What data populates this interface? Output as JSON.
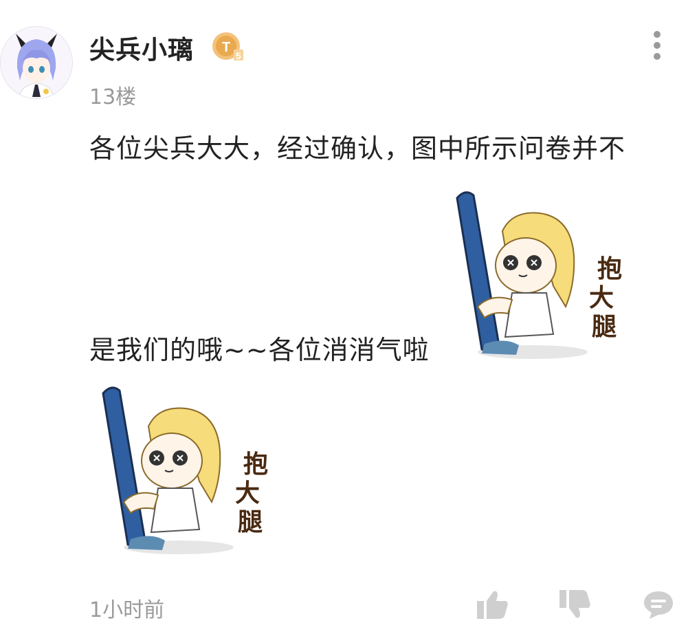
{
  "post": {
    "username": "尖兵小璃",
    "badge": "T5",
    "floor": "13楼",
    "content_line1": "各位尖兵大大，经过确认，图中所示问卷并不",
    "content_line2": "是我们的哦~~各位消消气啦",
    "sticker_text": [
      "抱",
      "大",
      "腿"
    ],
    "timestamp": "1小时前"
  },
  "icons": {
    "avatar": "anime-avatar-icon",
    "badge": "level-badge-icon",
    "more": "more-vertical-icon",
    "like": "thumbs-up-icon",
    "dislike": "thumbs-down-icon",
    "reply": "comment-icon"
  },
  "colors": {
    "badge_gold": "#e9a94f",
    "icon_gray": "#cfcfcf",
    "meta_gray": "#999999",
    "sticker_blue": "#2f5fa0",
    "sticker_hair": "#f6dc7a"
  }
}
